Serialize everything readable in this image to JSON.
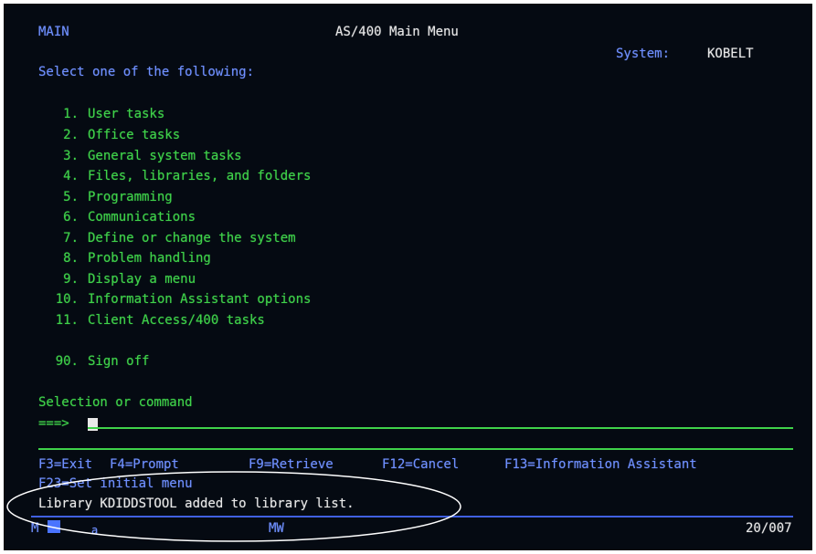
{
  "header": {
    "screen_id": "MAIN",
    "title": "AS/400 Main Menu",
    "system_label": "System:",
    "system_name": "KOBELT"
  },
  "instruction": "Select one of the following:",
  "menu_items": [
    {
      "number": "1.",
      "label": "User tasks"
    },
    {
      "number": "2.",
      "label": "Office tasks"
    },
    {
      "number": "3.",
      "label": "General system tasks"
    },
    {
      "number": "4.",
      "label": "Files, libraries, and folders"
    },
    {
      "number": "5.",
      "label": "Programming"
    },
    {
      "number": "6.",
      "label": "Communications"
    },
    {
      "number": "7.",
      "label": "Define or change the system"
    },
    {
      "number": "8.",
      "label": "Problem handling"
    },
    {
      "number": "9.",
      "label": "Display a menu"
    },
    {
      "number": "10.",
      "label": "Information Assistant options"
    },
    {
      "number": "11.",
      "label": "Client Access/400 tasks"
    }
  ],
  "signoff": {
    "number": "90.",
    "label": "Sign off"
  },
  "command": {
    "label": "Selection or command",
    "prompt": "===>",
    "value": ""
  },
  "function_keys": [
    "F3=Exit",
    "F4=Prompt",
    "F9=Retrieve",
    "F12=Cancel",
    "F13=Information Assistant"
  ],
  "function_keys_line2": "F23=Set initial menu",
  "message": "Library KDIDDSTOOL added to library list.",
  "status_bar": {
    "left": "M",
    "indicator": "a",
    "mode": "MW",
    "cursor_position": "20/007"
  },
  "colors": {
    "background": "#050a12",
    "text_green": "#3fd24a",
    "text_blue": "#6f90ff",
    "text_white": "#e8e8e8",
    "annotation_ellipse": "#ffffff"
  }
}
